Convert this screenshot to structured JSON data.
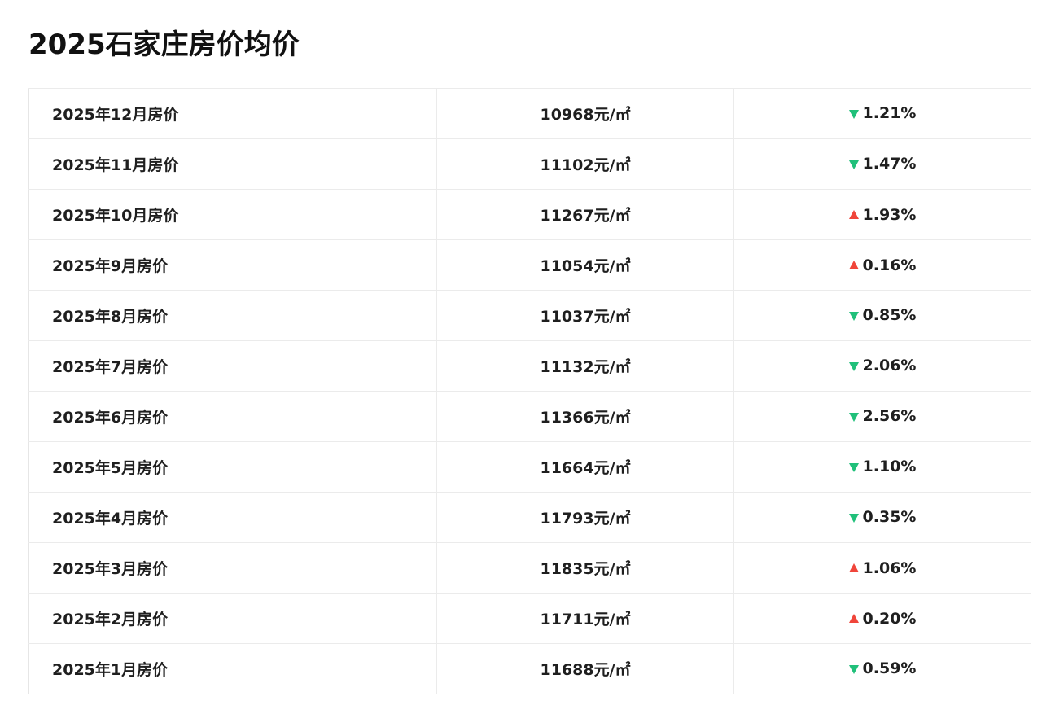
{
  "page": {
    "title": "2025石家庄房价均价"
  },
  "colors": {
    "down": "#20c07a",
    "up": "#f0453a"
  },
  "rows": [
    {
      "month": "2025年12月房价",
      "price": "10968元/㎡",
      "direction": "down",
      "change": "1.21%"
    },
    {
      "month": "2025年11月房价",
      "price": "11102元/㎡",
      "direction": "down",
      "change": "1.47%"
    },
    {
      "month": "2025年10月房价",
      "price": "11267元/㎡",
      "direction": "up",
      "change": "1.93%"
    },
    {
      "month": "2025年9月房价",
      "price": "11054元/㎡",
      "direction": "up",
      "change": "0.16%"
    },
    {
      "month": "2025年8月房价",
      "price": "11037元/㎡",
      "direction": "down",
      "change": "0.85%"
    },
    {
      "month": "2025年7月房价",
      "price": "11132元/㎡",
      "direction": "down",
      "change": "2.06%"
    },
    {
      "month": "2025年6月房价",
      "price": "11366元/㎡",
      "direction": "down",
      "change": "2.56%"
    },
    {
      "month": "2025年5月房价",
      "price": "11664元/㎡",
      "direction": "down",
      "change": "1.10%"
    },
    {
      "month": "2025年4月房价",
      "price": "11793元/㎡",
      "direction": "down",
      "change": "0.35%"
    },
    {
      "month": "2025年3月房价",
      "price": "11835元/㎡",
      "direction": "up",
      "change": "1.06%"
    },
    {
      "month": "2025年2月房价",
      "price": "11711元/㎡",
      "direction": "up",
      "change": "0.20%"
    },
    {
      "month": "2025年1月房价",
      "price": "11688元/㎡",
      "direction": "down",
      "change": "0.59%"
    }
  ]
}
